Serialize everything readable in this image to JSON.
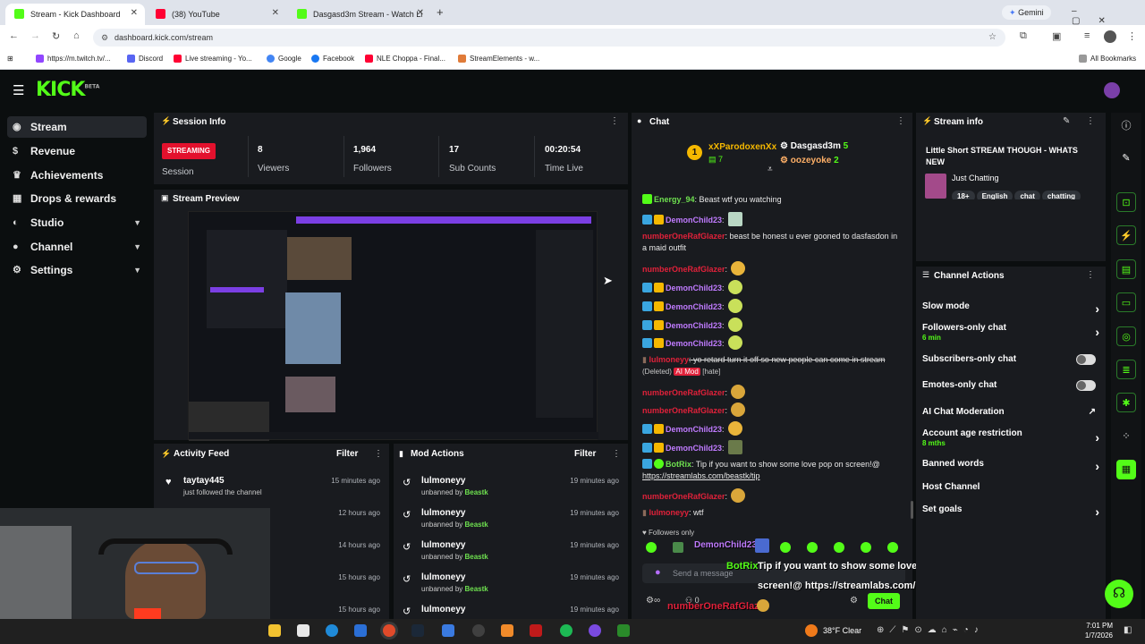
{
  "browser": {
    "tabs": [
      {
        "title": "Stream - Kick Dashboard",
        "active": true,
        "color": "#53fc18"
      },
      {
        "title": "(38) YouTube",
        "active": false,
        "color": "#ff0033"
      },
      {
        "title": "Dasgasd3m Stream - Watch Li",
        "active": false,
        "color": "#53fc18"
      }
    ],
    "new_tab": "+",
    "gemini": "Gemini",
    "url": "dashboard.kick.com/stream",
    "bookmarks": [
      "https://m.twitch.tv/...",
      "Discord",
      "Live streaming - Yo...",
      "Google",
      "Facebook",
      "NLE Choppa - Final...",
      "StreamElements - w..."
    ],
    "all_bookmarks": "All Bookmarks"
  },
  "kick": {
    "logo": "KICK",
    "logo_sup": "BETA",
    "sidebar": [
      {
        "label": "Stream",
        "icon": "wifi-icon",
        "active": true
      },
      {
        "label": "Revenue",
        "icon": "dollar-icon"
      },
      {
        "label": "Achievements",
        "icon": "trophy-icon"
      },
      {
        "label": "Drops & rewards",
        "icon": "gift-icon"
      },
      {
        "label": "Studio",
        "icon": "studio-icon",
        "chevron": "▼"
      },
      {
        "label": "Channel",
        "icon": "user-icon",
        "chevron": "▼"
      },
      {
        "label": "Settings",
        "icon": "gear-icon",
        "chevron": "▼"
      }
    ],
    "session": {
      "title": "Session Info",
      "streaming_badge": "STREAMING",
      "session_label": "Session",
      "stats": [
        {
          "value": "8",
          "label": "Viewers"
        },
        {
          "value": "1,964",
          "label": "Followers"
        },
        {
          "value": "17",
          "label": "Sub Counts"
        },
        {
          "value": "00:20:54",
          "label": "Time Live"
        }
      ]
    },
    "preview_title": "Stream Preview",
    "activity": {
      "title": "Activity Feed",
      "filter": "Filter",
      "rows": [
        {
          "name": "taytay445",
          "sub": "just followed the channel",
          "time": "15 minutes ago"
        },
        {
          "name": "",
          "sub": "",
          "time": "12 hours ago"
        },
        {
          "name": "",
          "sub": "",
          "time": "14 hours ago"
        },
        {
          "name": "",
          "sub": "",
          "time": "15 hours ago"
        },
        {
          "name": "",
          "sub": "",
          "time": "15 hours ago"
        }
      ]
    },
    "mod_actions": {
      "title": "Mod Actions",
      "filter": "Filter",
      "rows": [
        {
          "name": "lulmoneyy",
          "prefix": "unbanned by",
          "by": "Beastk",
          "time": "19 minutes ago"
        },
        {
          "name": "lulmoneyy",
          "prefix": "unbanned by",
          "by": "Beastk",
          "time": "19 minutes ago"
        },
        {
          "name": "lulmoneyy",
          "prefix": "unbanned by",
          "by": "Beastk",
          "time": "19 minutes ago"
        },
        {
          "name": "lulmoneyy",
          "prefix": "unbanned by",
          "by": "Beastk",
          "time": "19 minutes ago"
        },
        {
          "name": "lulmoneyy",
          "prefix": "",
          "by": "",
          "time": "19 minutes ago"
        }
      ]
    },
    "chat": {
      "title": "Chat",
      "top_gifters": [
        {
          "rank": "1",
          "name": "xXParodoxenXx",
          "count": "7"
        },
        {
          "name": "Dasgasd3m",
          "count": "5"
        },
        {
          "name": "oozeyoke",
          "count": "2"
        }
      ],
      "messages": [
        {
          "user": "Energy_94",
          "text": ": Beast wtf you watching"
        },
        {
          "user": "DemonChild23",
          "text": ":"
        },
        {
          "user": "numberOneRafGlazer",
          "text": ": beast be honest u ever gooned to dasfasdon in a maid outfit"
        },
        {
          "user": "numberOneRafGlazer",
          "text": ":"
        },
        {
          "user": "DemonChild23",
          "text": ":"
        },
        {
          "user": "DemonChild23",
          "text": ":"
        },
        {
          "user": "DemonChild23",
          "text": ":"
        },
        {
          "user": "DemonChild23",
          "text": ":"
        },
        {
          "user": "lulmoneyy",
          "text": ": yo retard turn it off so new people can come in stream",
          "deleted": "(Deleted)",
          "ai_mod": "AI Mod",
          "tag": "[hate]"
        },
        {
          "user": "numberOneRafGlazer",
          "text": ":"
        },
        {
          "user": "numberOneRafGlazer",
          "text": ":"
        },
        {
          "user": "DemonChild23",
          "text": ":"
        },
        {
          "user": "DemonChild23",
          "text": ":"
        },
        {
          "user": "BotRix",
          "text": ": Tip if you want to show some love pop on screen!@ ",
          "link": "https://streamlabs.com/beastk/tip"
        },
        {
          "user": "numberOneRafGlazer",
          "text": ":"
        },
        {
          "user": "lulmoneyy",
          "text": ": wtf"
        }
      ],
      "followers_only": "Followers only",
      "placeholder": "Send a message",
      "chat_button": "Chat",
      "viewer_count": "0"
    },
    "stream_info": {
      "title": "Stream info",
      "stream_title": "Little Short STREAM THOUGH - WHATS NEW",
      "category": "Just Chatting",
      "tags": [
        "18+",
        "English",
        "chat",
        "chatting"
      ]
    },
    "channel_actions": {
      "title": "Channel Actions",
      "items": [
        {
          "label": "Slow mode",
          "sub": "",
          "control": "chevron"
        },
        {
          "label": "Followers-only chat",
          "sub": "6 min",
          "control": "chevron"
        },
        {
          "label": "Subscribers-only chat",
          "sub": "",
          "control": "toggle"
        },
        {
          "label": "Emotes-only chat",
          "sub": "",
          "control": "toggle"
        },
        {
          "label": "AI Chat Moderation",
          "sub": "",
          "control": "external"
        },
        {
          "label": "Account age restriction",
          "sub": "8 mths",
          "control": "chevron"
        },
        {
          "label": "Banned words",
          "sub": "",
          "control": "chevron"
        },
        {
          "label": "Host Channel",
          "sub": "",
          "control": "none"
        },
        {
          "label": "Set goals",
          "sub": "",
          "control": "chevron"
        }
      ]
    },
    "overlay": {
      "demon": "DemonChild23",
      "botrix": "BotRix",
      "botrix_msg_1": "Tip if you want to show some love pop on",
      "botrix_msg_2": "screen!@ https://streamlabs.com/beastk/tip",
      "rafglazer": "numberOneRafGlazer",
      "lulmoneyy": "lulmoneyy",
      "wtf": "wtf"
    }
  },
  "taskbar": {
    "weather": "38°F  Clear",
    "time": "7:01 PM",
    "date": "1/7/2026"
  }
}
